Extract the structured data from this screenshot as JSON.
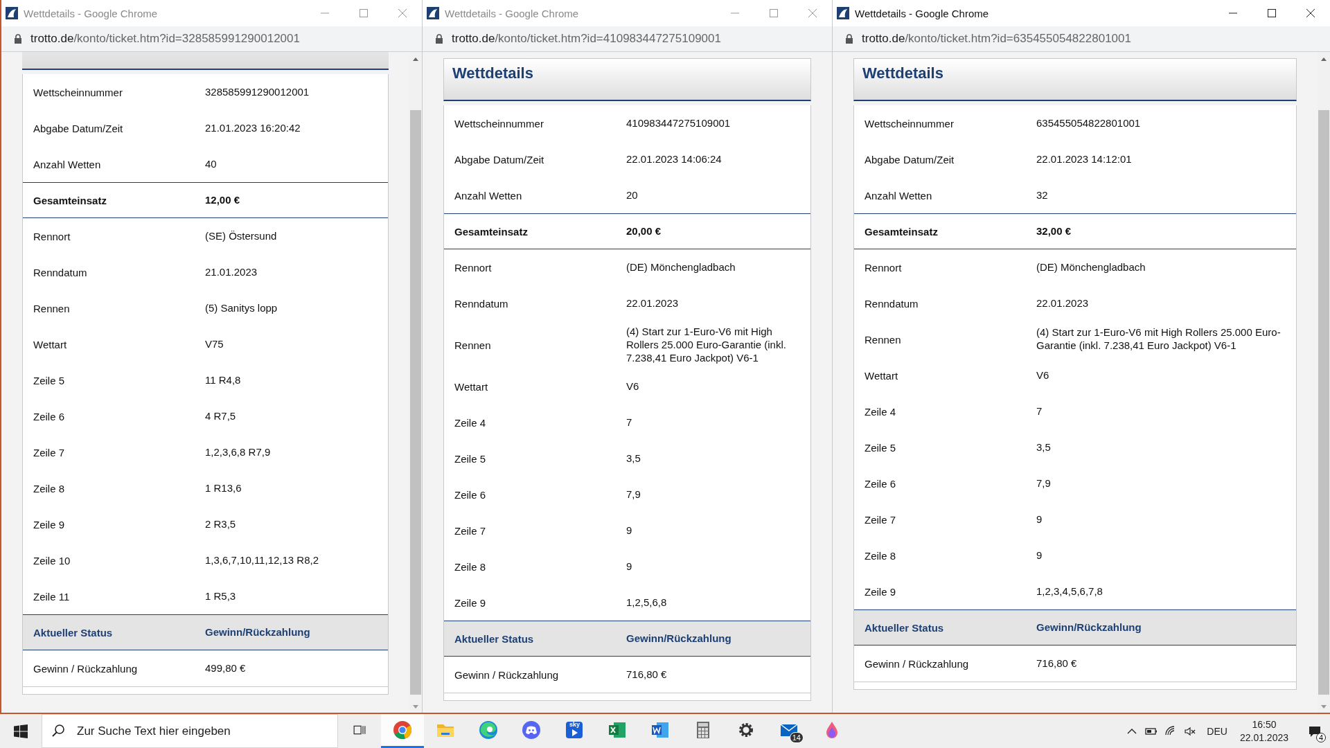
{
  "windows": [
    {
      "title": "Wettdetails - Google Chrome",
      "active": false,
      "url_host": "trotto.de",
      "url_path": "/konto/ticket.htm?id=328585991290012001",
      "scrollbar": true,
      "rows": [
        {
          "kind": "plain",
          "label": "Wettscheinnummer",
          "value": "328585991290012001"
        },
        {
          "kind": "plain",
          "label": "Abgabe Datum/Zeit",
          "value": "21.01.2023 16:20:42"
        },
        {
          "kind": "plain",
          "label": "Anzahl Wetten",
          "value": "40"
        },
        {
          "kind": "total",
          "label": "Gesamteinsatz",
          "value": "12,00 €"
        },
        {
          "kind": "plain",
          "label": "Rennort",
          "value": "(SE) Östersund"
        },
        {
          "kind": "plain",
          "label": "Renndatum",
          "value": "21.01.2023"
        },
        {
          "kind": "plain",
          "label": "Rennen",
          "value": "(5) Sanitys lopp"
        },
        {
          "kind": "plain",
          "label": "Wettart",
          "value": "V75"
        },
        {
          "kind": "plain",
          "label": "Zeile 5",
          "value": "11 R4,8"
        },
        {
          "kind": "plain",
          "label": "Zeile 6",
          "value": "4 R7,5"
        },
        {
          "kind": "plain",
          "label": "Zeile 7",
          "value": "1,2,3,6,8 R7,9"
        },
        {
          "kind": "plain",
          "label": "Zeile 8",
          "value": "1 R13,6"
        },
        {
          "kind": "plain",
          "label": "Zeile 9",
          "value": "2 R3,5"
        },
        {
          "kind": "plain",
          "label": "Zeile 10",
          "value": "1,3,6,7,10,11,12,13 R8,2"
        },
        {
          "kind": "plain",
          "label": "Zeile 11",
          "value": "1 R5,3"
        },
        {
          "kind": "status",
          "label": "Aktueller Status",
          "value": "Gewinn/Rückzahlung"
        },
        {
          "kind": "plain",
          "label": "Gewinn / Rückzahlung",
          "value": "499,80 €"
        }
      ]
    },
    {
      "title": "Wettdetails - Google Chrome",
      "active": false,
      "url_host": "trotto.de",
      "url_path": "/konto/ticket.htm?id=410983447275109001",
      "scrollbar": false,
      "heading": "Wettdetails",
      "rows": [
        {
          "kind": "plain",
          "label": "Wettscheinnummer",
          "value": "410983447275109001"
        },
        {
          "kind": "plain",
          "label": "Abgabe Datum/Zeit",
          "value": "22.01.2023 14:06:24"
        },
        {
          "kind": "plain",
          "label": "Anzahl Wetten",
          "value": "20"
        },
        {
          "kind": "total",
          "label": "Gesamteinsatz",
          "value": "20,00 €"
        },
        {
          "kind": "plain",
          "label": "Rennort",
          "value": "(DE) Mönchengladbach"
        },
        {
          "kind": "plain",
          "label": "Renndatum",
          "value": "22.01.2023"
        },
        {
          "kind": "plain",
          "label": "Rennen",
          "value": "(4) Start zur 1-Euro-V6 mit High Rollers 25.000 Euro-Garantie (inkl. 7.238,41 Euro Jackpot) V6-1"
        },
        {
          "kind": "plain",
          "label": "Wettart",
          "value": "V6"
        },
        {
          "kind": "plain",
          "label": "Zeile 4",
          "value": "7"
        },
        {
          "kind": "plain",
          "label": "Zeile 5",
          "value": "3,5"
        },
        {
          "kind": "plain",
          "label": "Zeile 6",
          "value": "7,9"
        },
        {
          "kind": "plain",
          "label": "Zeile 7",
          "value": "9"
        },
        {
          "kind": "plain",
          "label": "Zeile 8",
          "value": "9"
        },
        {
          "kind": "plain",
          "label": "Zeile 9",
          "value": "1,2,5,6,8"
        },
        {
          "kind": "status",
          "label": "Aktueller Status",
          "value": "Gewinn/Rückzahlung"
        },
        {
          "kind": "plain",
          "label": "Gewinn / Rückzahlung",
          "value": "716,80 €"
        }
      ]
    },
    {
      "title": "Wettdetails - Google Chrome",
      "active": true,
      "url_host": "trotto.de",
      "url_path": "/konto/ticket.htm?id=635455054822801001",
      "scrollbar": true,
      "heading": "Wettdetails",
      "rows": [
        {
          "kind": "plain",
          "label": "Wettscheinnummer",
          "value": "635455054822801001"
        },
        {
          "kind": "plain",
          "label": "Abgabe Datum/Zeit",
          "value": "22.01.2023 14:12:01"
        },
        {
          "kind": "plain",
          "label": "Anzahl Wetten",
          "value": "32"
        },
        {
          "kind": "total",
          "label": "Gesamteinsatz",
          "value": "32,00 €"
        },
        {
          "kind": "plain",
          "label": "Rennort",
          "value": "(DE) Mönchengladbach"
        },
        {
          "kind": "plain",
          "label": "Renndatum",
          "value": "22.01.2023"
        },
        {
          "kind": "plain",
          "label": "Rennen",
          "value": "(4) Start zur 1-Euro-V6 mit High Rollers 25.000 Euro-Garantie (inkl. 7.238,41 Euro Jackpot) V6-1"
        },
        {
          "kind": "plain",
          "label": "Wettart",
          "value": "V6"
        },
        {
          "kind": "plain",
          "label": "Zeile 4",
          "value": "7"
        },
        {
          "kind": "plain",
          "label": "Zeile 5",
          "value": "3,5"
        },
        {
          "kind": "plain",
          "label": "Zeile 6",
          "value": "7,9"
        },
        {
          "kind": "plain",
          "label": "Zeile 7",
          "value": "9"
        },
        {
          "kind": "plain",
          "label": "Zeile 8",
          "value": "9"
        },
        {
          "kind": "plain",
          "label": "Zeile 9",
          "value": "1,2,3,4,5,6,7,8"
        },
        {
          "kind": "status",
          "label": "Aktueller Status",
          "value": "Gewinn/Rückzahlung"
        },
        {
          "kind": "plain",
          "label": "Gewinn / Rückzahlung",
          "value": "716,80 €"
        }
      ]
    }
  ],
  "taskbar": {
    "search_placeholder": "Zur Suche Text hier eingeben",
    "apps": [
      {
        "kind": "chrome",
        "selected": true
      },
      {
        "kind": "folder",
        "selected": false
      },
      {
        "kind": "edge",
        "selected": false
      },
      {
        "kind": "discord",
        "selected": false
      },
      {
        "kind": "sky",
        "selected": false,
        "label": "sky"
      },
      {
        "kind": "excel",
        "selected": false
      },
      {
        "kind": "word",
        "selected": false
      },
      {
        "kind": "calculator",
        "selected": false
      },
      {
        "kind": "settings",
        "selected": false
      },
      {
        "kind": "mail",
        "selected": false,
        "badge": "14"
      },
      {
        "kind": "paint",
        "selected": false
      }
    ],
    "language": "DEU",
    "time": "16:50",
    "date": "22.01.2023",
    "notifications": "4"
  }
}
